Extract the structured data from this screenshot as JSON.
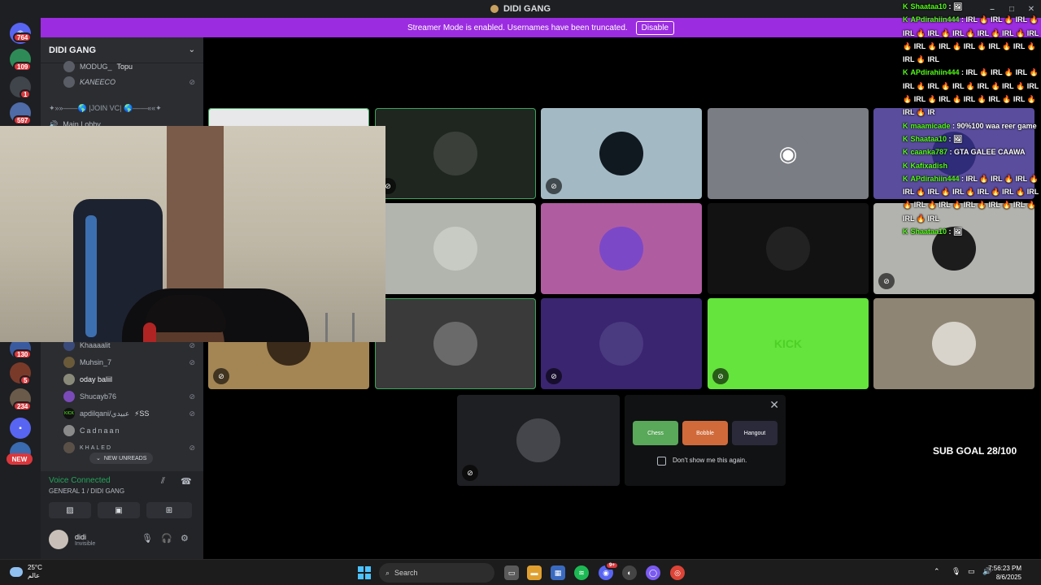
{
  "window": {
    "title": "DIDI GANG",
    "controls": [
      "–",
      "□",
      "✕"
    ]
  },
  "banner": {
    "text": "Streamer Mode is enabled. Usernames have been truncated.",
    "button": "Disable"
  },
  "rail": {
    "badges": [
      "764",
      "109",
      "1",
      "597",
      "130",
      "5",
      "234"
    ],
    "new_label": "NEW"
  },
  "sidebar": {
    "server_name": "DIDI GANG",
    "top_members": [
      "MODUG_",
      "KANEECO"
    ],
    "top_member_tag": "Topu",
    "category": "✦»»——🌎 |JOIN VC| 🌎——««✦",
    "lobby": "Main Lobby",
    "members": [
      {
        "name": "Khaaaalit"
      },
      {
        "name": "Muhsin_7"
      },
      {
        "name": "oday baliil"
      },
      {
        "name": "Shucayb76"
      },
      {
        "name": "apdilqani/عبيدي",
        "extra": "⚡SS"
      },
      {
        "name": "Cadnaan"
      },
      {
        "name": "KHALED"
      }
    ],
    "new_unreads": "NEW UNREADS"
  },
  "voice_panel": {
    "status": "Voice Connected",
    "channel": "GENERAL 1 / DIDI GANG",
    "user_name": "didi",
    "user_status": "Invisible"
  },
  "tiles": [
    {
      "color": "#e8e8ea",
      "pic": "#e8e8ea",
      "muted": false,
      "speaking": true
    },
    {
      "color": "#1f2620",
      "pic": "#3a3f3a",
      "muted": true,
      "speaking": true
    },
    {
      "color": "#a3bac4",
      "pic": "#101820",
      "muted": true,
      "speaking": false
    },
    {
      "color": "#7b7d84",
      "pic": "#7b7d84",
      "muted": false,
      "speaking": false,
      "discord": true
    },
    {
      "color": "#5a4d9e",
      "pic": "#2f2c7a",
      "muted": false,
      "speaking": false
    },
    {
      "color": "#d8d0cc",
      "pic": "#d4c0b0",
      "muted": false,
      "speaking": false
    },
    {
      "color": "#b2b4ae",
      "pic": "#c8cac4",
      "muted": false,
      "speaking": false
    },
    {
      "color": "#b05ca0",
      "pic": "#7b48c8",
      "muted": false,
      "speaking": false
    },
    {
      "color": "#121212",
      "pic": "#222222",
      "muted": false,
      "speaking": false
    },
    {
      "color": "#b2b3ae",
      "pic": "#1c1c1c",
      "muted": true,
      "speaking": false
    },
    {
      "color": "#a48654",
      "pic": "#3a2a1a",
      "muted": true,
      "speaking": false
    },
    {
      "color": "#3a3a3a",
      "pic": "#6a6a6a",
      "muted": false,
      "speaking": true
    },
    {
      "color": "#3a2570",
      "pic": "#4a3a80",
      "muted": true,
      "speaking": false
    },
    {
      "color": "#64e43c",
      "pic": "#64e43c",
      "muted": true,
      "speaking": false,
      "label": "KICK"
    },
    {
      "color": "#8f8574",
      "pic": "#d8d4cc",
      "muted": false,
      "speaking": false
    }
  ],
  "promo": {
    "apps": [
      "Chess",
      "Bobble",
      "Hangout"
    ],
    "checkbox_label": "Don't show me this again."
  },
  "sub_goal": "SUB GOAL 28/100",
  "chat": [
    {
      "user": "Shaataa10",
      "text": "🖼"
    },
    {
      "user": "APdirahiin444",
      "text": "IRL 🔥 IRL 🔥 IRL 🔥 IRL 🔥 IRL 🔥 IRL 🔥 IRL 🔥 IRL 🔥 IRL 🔥 IRL 🔥 IRL 🔥 IRL 🔥 IRL 🔥 IRL 🔥 IRL 🔥 IRL"
    },
    {
      "user": "APdirahiin444",
      "text": "IRL 🔥 IRL 🔥 IRL 🔥 IRL 🔥 IRL 🔥 IRL 🔥 IRL 🔥 IRL 🔥 IRL 🔥 IRL 🔥 IRL 🔥 IRL 🔥 IRL 🔥 IRL 🔥 IRL 🔥 IR"
    },
    {
      "user": "maamicade",
      "text": "90%100 waa reer game"
    },
    {
      "user": "Shaataa10",
      "text": "🖼"
    },
    {
      "user": "caanka787",
      "text": "GTA GALEE CAAWA"
    },
    {
      "user": "Kafixadish",
      "text": ""
    },
    {
      "user": "APdirahiin444",
      "text": "IRL 🔥 IRL 🔥 IRL 🔥 IRL 🔥 IRL 🔥 IRL 🔥 IRL 🔥 IRL 🔥 IRL 🔥 IRL 🔥 IRL 🔥 IRL 🔥 IRL 🔥 IRL 🔥 IRL 🔥 IRL"
    },
    {
      "user": "Shaataa10",
      "text": "🖼"
    }
  ],
  "taskbar": {
    "temperature": "25°C",
    "weather_label": "عالم",
    "search_placeholder": "Search",
    "time": "7:56:23 PM",
    "date": "8/6/2025",
    "apps_badge": "9+"
  }
}
